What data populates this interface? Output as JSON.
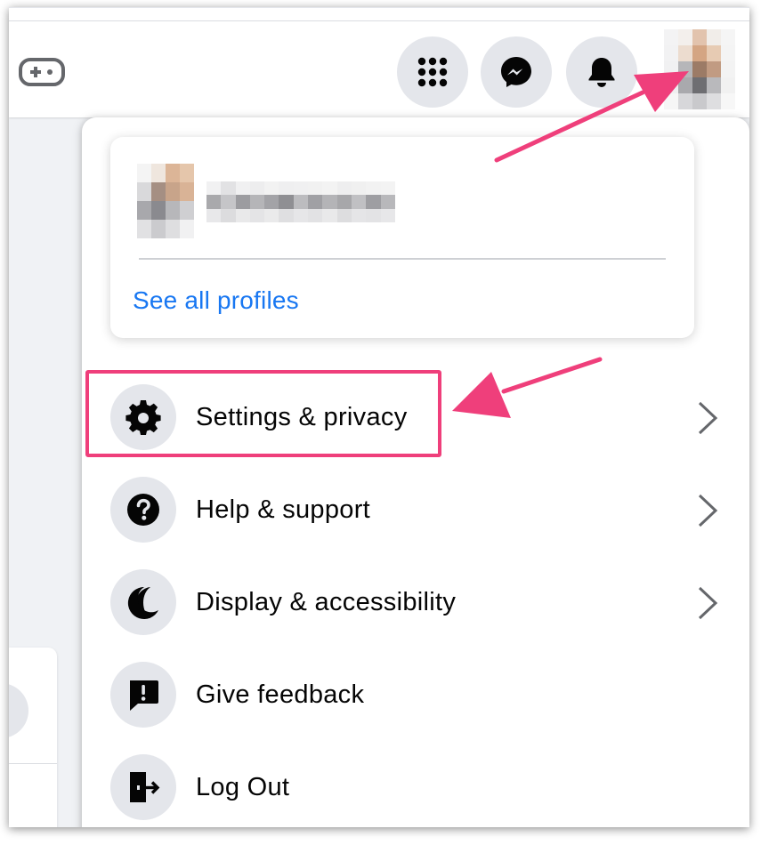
{
  "profile": {
    "see_all_label": "See all profiles"
  },
  "menu": {
    "items": [
      {
        "label": "Settings & privacy",
        "icon": "gear-icon",
        "has_chevron": true
      },
      {
        "label": "Help & support",
        "icon": "question-icon",
        "has_chevron": true
      },
      {
        "label": "Display & accessibility",
        "icon": "moon-icon",
        "has_chevron": true
      },
      {
        "label": "Give feedback",
        "icon": "feedback-icon",
        "has_chevron": false
      },
      {
        "label": "Log Out",
        "icon": "logout-icon",
        "has_chevron": false
      }
    ]
  },
  "topbar": {
    "buttons": [
      "menu-grid-icon",
      "messenger-icon",
      "bell-icon"
    ]
  },
  "colors": {
    "accent_link": "#1877f2",
    "annotation": "#ef3f7b",
    "icon_bg": "#e4e6eb"
  }
}
